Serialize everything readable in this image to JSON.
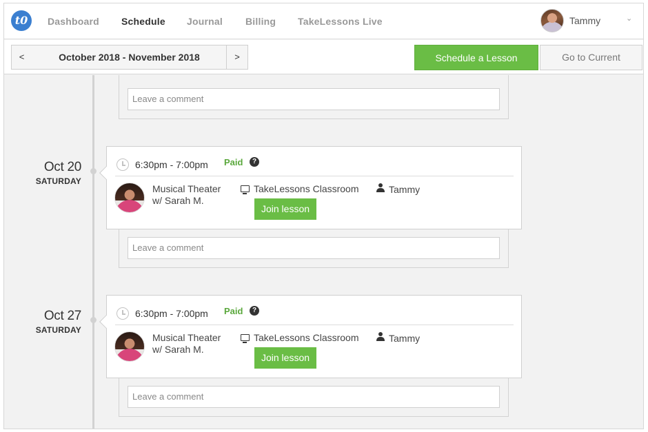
{
  "nav": {
    "logo_text": "t0",
    "items": [
      "Dashboard",
      "Schedule",
      "Journal",
      "Billing",
      "TakeLessons Live"
    ],
    "active": "Schedule",
    "user_name": "Tammy",
    "user_caret": "⌄"
  },
  "toolbar": {
    "prev_label": "<",
    "next_label": ">",
    "date_range": "October 2018 - November 2018",
    "schedule_label": "Schedule a Lesson",
    "current_label": "Go to Current"
  },
  "comment_placeholder": "Leave a comment",
  "lessons": [
    {
      "day": "Oct 20",
      "weekday": "SATURDAY",
      "time": "6:30pm - 7:00pm",
      "status": "Paid",
      "help": "?",
      "course_line1": "Musical Theater",
      "course_line2": "w/ Sarah M.",
      "location": "TakeLessons Classroom",
      "student": "Tammy",
      "join_label": "Join lesson"
    },
    {
      "day": "Oct 27",
      "weekday": "SATURDAY",
      "time": "6:30pm - 7:00pm",
      "status": "Paid",
      "help": "?",
      "course_line1": "Musical Theater",
      "course_line2": "w/ Sarah M.",
      "location": "TakeLessons Classroom",
      "student": "Tammy",
      "join_label": "Join lesson"
    }
  ],
  "colors": {
    "accent_green": "#6abd45",
    "paid_green": "#5aa83c",
    "logo_blue": "#3b7fd0"
  }
}
